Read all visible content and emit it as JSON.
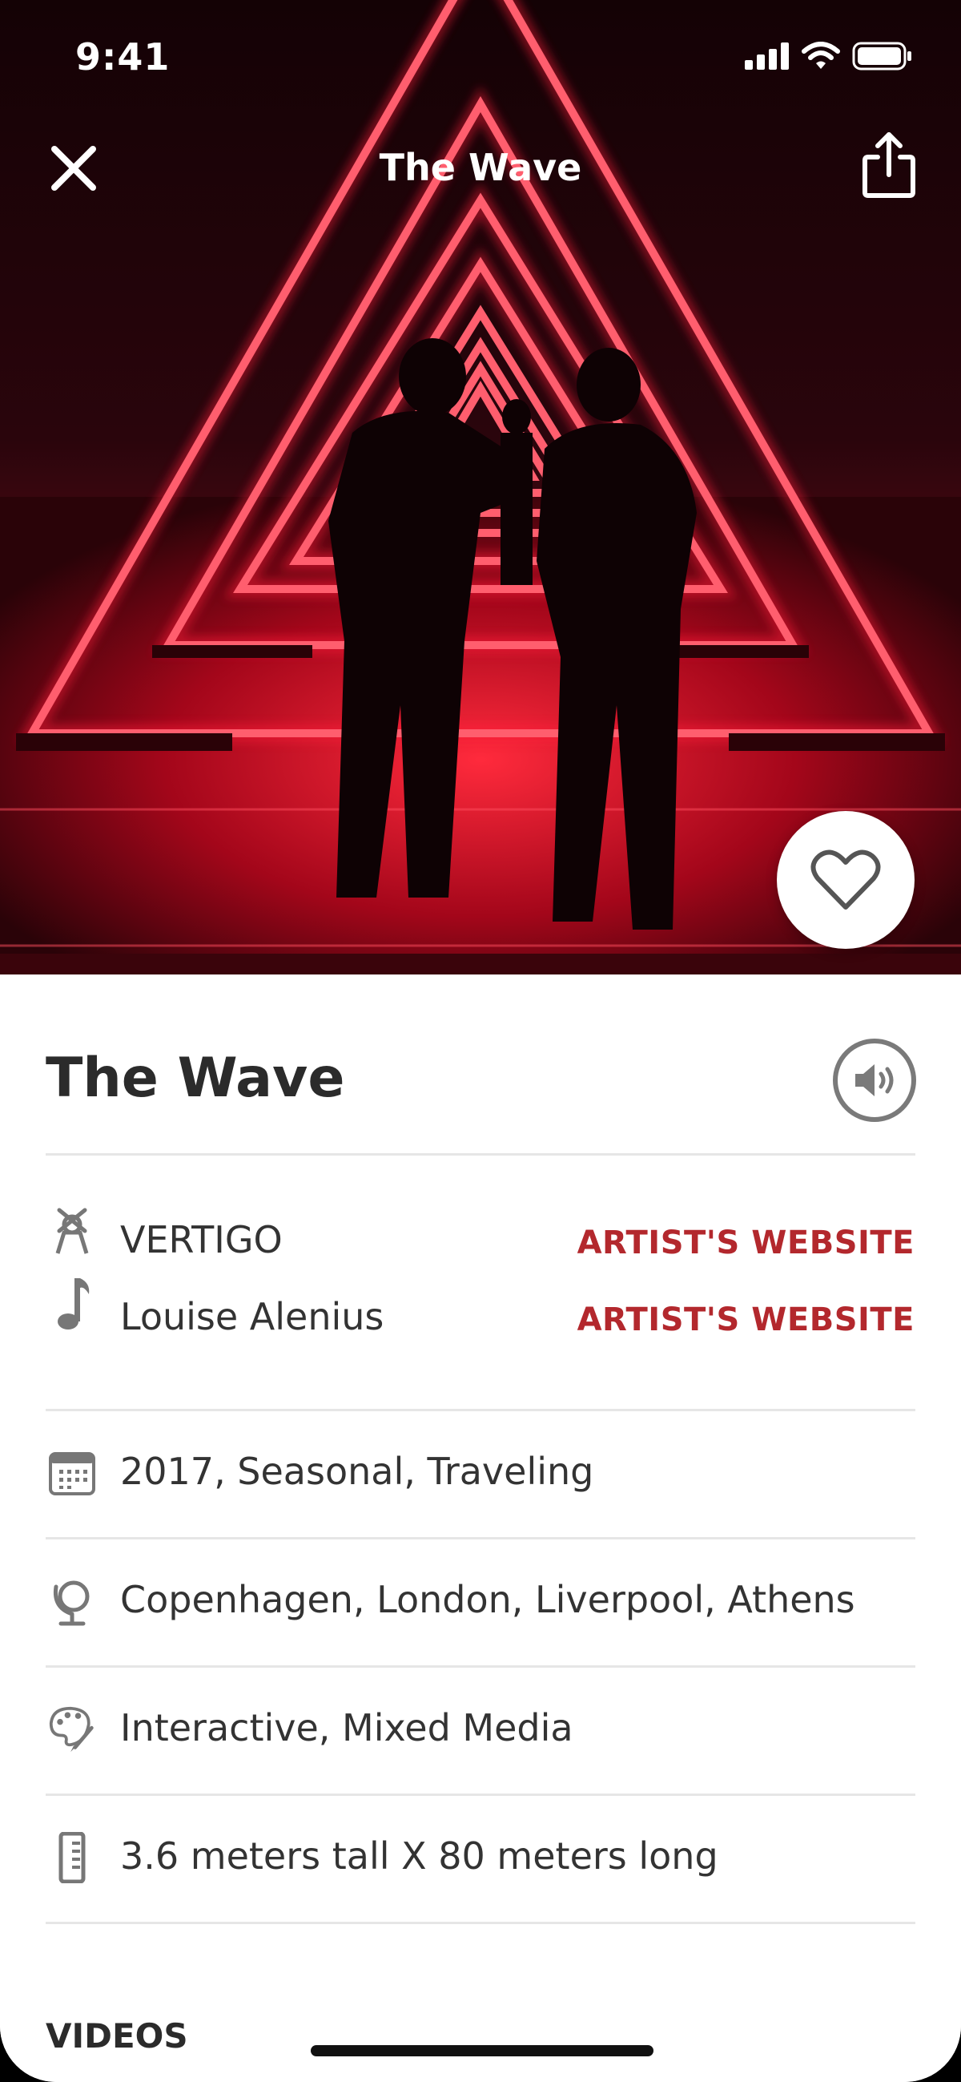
{
  "status_bar": {
    "time": "9:41"
  },
  "nav": {
    "title": "The Wave"
  },
  "artwork": {
    "title": "The Wave",
    "credits": [
      {
        "name": "VERTIGO",
        "icon": "artist-icon",
        "link_label": "ARTIST'S WEBSITE"
      },
      {
        "name": "Louise Alenius",
        "icon": "music-note-icon",
        "link_label": "ARTIST'S WEBSITE"
      }
    ],
    "details": [
      {
        "icon": "calendar-icon",
        "text": "2017, Seasonal, Traveling"
      },
      {
        "icon": "globe-icon",
        "text": "Copenhagen, London, Liverpool, Athens"
      },
      {
        "icon": "palette-icon",
        "text": "Interactive, Mixed Media"
      },
      {
        "icon": "ruler-icon",
        "text": "3.6 meters tall X 80 meters long"
      }
    ],
    "section_videos": "VIDEOS"
  },
  "colors": {
    "accent": "#b3282d",
    "text": "#333333",
    "neon": "#ff1d3a"
  }
}
